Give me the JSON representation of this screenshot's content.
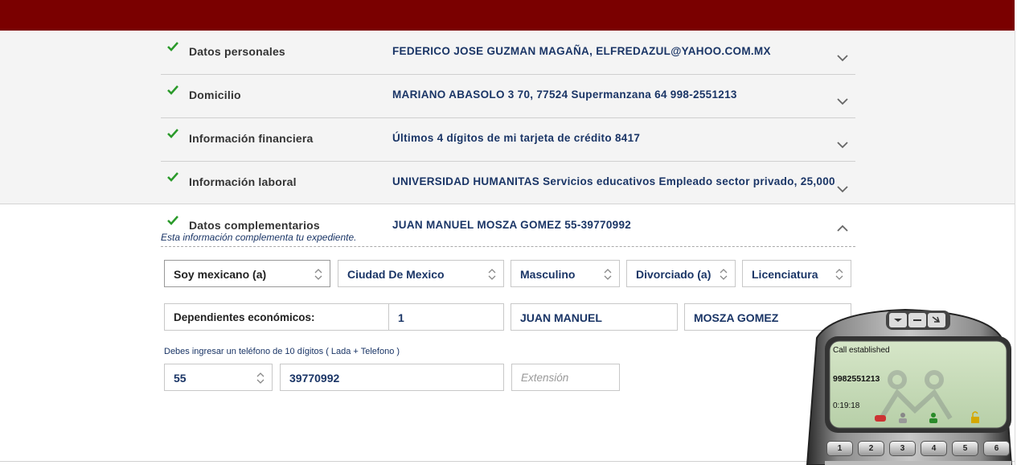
{
  "sections": [
    {
      "label": "Datos personales",
      "value": "FEDERICO JOSE GUZMAN MAGAÑA, ELFREDAZUL@YAHOO.COM.MX"
    },
    {
      "label": "Domicilio",
      "value": "MARIANO ABASOLO 3 70, 77524 Supermanzana 64 998-2551213"
    },
    {
      "label": "Información financiera",
      "value": "Últimos 4 dígitos de mi tarjeta de crédito 8417"
    },
    {
      "label": "Información laboral",
      "value": "UNIVERSIDAD HUMANITAS Servicios educativos Empleado sector privado, 25,000"
    },
    {
      "label": "Datos complementarios",
      "value": "JUAN MANUEL MOSZA GOMEZ 55-39770992"
    }
  ],
  "complementary_subtitle": "Esta información complementa tu expediente.",
  "selects": {
    "nationality": "Soy mexicano (a)",
    "state": "Ciudad De Mexico",
    "gender": "Masculino",
    "marital_status": "Divorciado (a)",
    "education": "Licenciatura"
  },
  "dependents_label": "Dependientes económicos:",
  "dependents_value": "1",
  "first_name": "JUAN MANUEL",
  "last_name": "MOSZA GOMEZ",
  "phone_hint": "Debes ingresar un teléfono de 10 dígitos ( Lada + Telefono )",
  "lada": "55",
  "phone_number": "39770992",
  "extension_placeholder": "Extensión",
  "softphone": {
    "status": "Call established",
    "number": "9982551213",
    "timer": "0:19:18",
    "keys": [
      "1",
      "2",
      "3",
      "4",
      "5",
      "6"
    ]
  },
  "colors": {
    "header": "#7a0000",
    "value_text": "#1a3566",
    "check": "#2a9a2a"
  }
}
